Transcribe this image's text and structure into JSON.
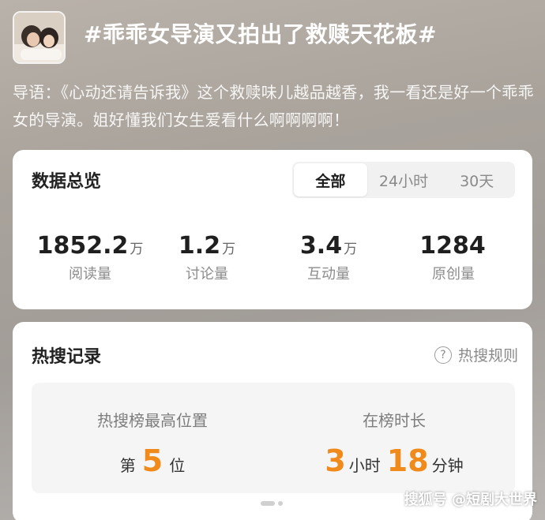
{
  "topic": {
    "title": "#乖乖女导演又拍出了救赎天花板#",
    "intro": "导语：《心动还请告诉我》这个救赎味儿越品越香，我一看还是好一个乖乖女的导演。姐好懂我们女生爱看什么啊啊啊啊！"
  },
  "overview": {
    "heading": "数据总览",
    "tabs": [
      {
        "label": "全部",
        "active": true
      },
      {
        "label": "24小时",
        "active": false
      },
      {
        "label": "30天",
        "active": false
      }
    ],
    "stats": [
      {
        "value": "1852.2",
        "unit": "万",
        "label": "阅读量"
      },
      {
        "value": "1.2",
        "unit": "万",
        "label": "讨论量"
      },
      {
        "value": "3.4",
        "unit": "万",
        "label": "互动量"
      },
      {
        "value": "1284",
        "unit": "",
        "label": "原创量"
      }
    ]
  },
  "hot_search": {
    "heading": "热搜记录",
    "rules_label": "热搜规则",
    "peak_label": "热搜榜最高位置",
    "peak_prefix": "第",
    "peak_value": "5",
    "peak_suffix": "位",
    "duration_label": "在榜时长",
    "hours_value": "3",
    "hours_unit": "小时",
    "minutes_value": "18",
    "minutes_unit": "分钟"
  },
  "watermark": "搜狐号 @短剧大世界",
  "colors": {
    "accent_orange": "#f08a1b"
  }
}
